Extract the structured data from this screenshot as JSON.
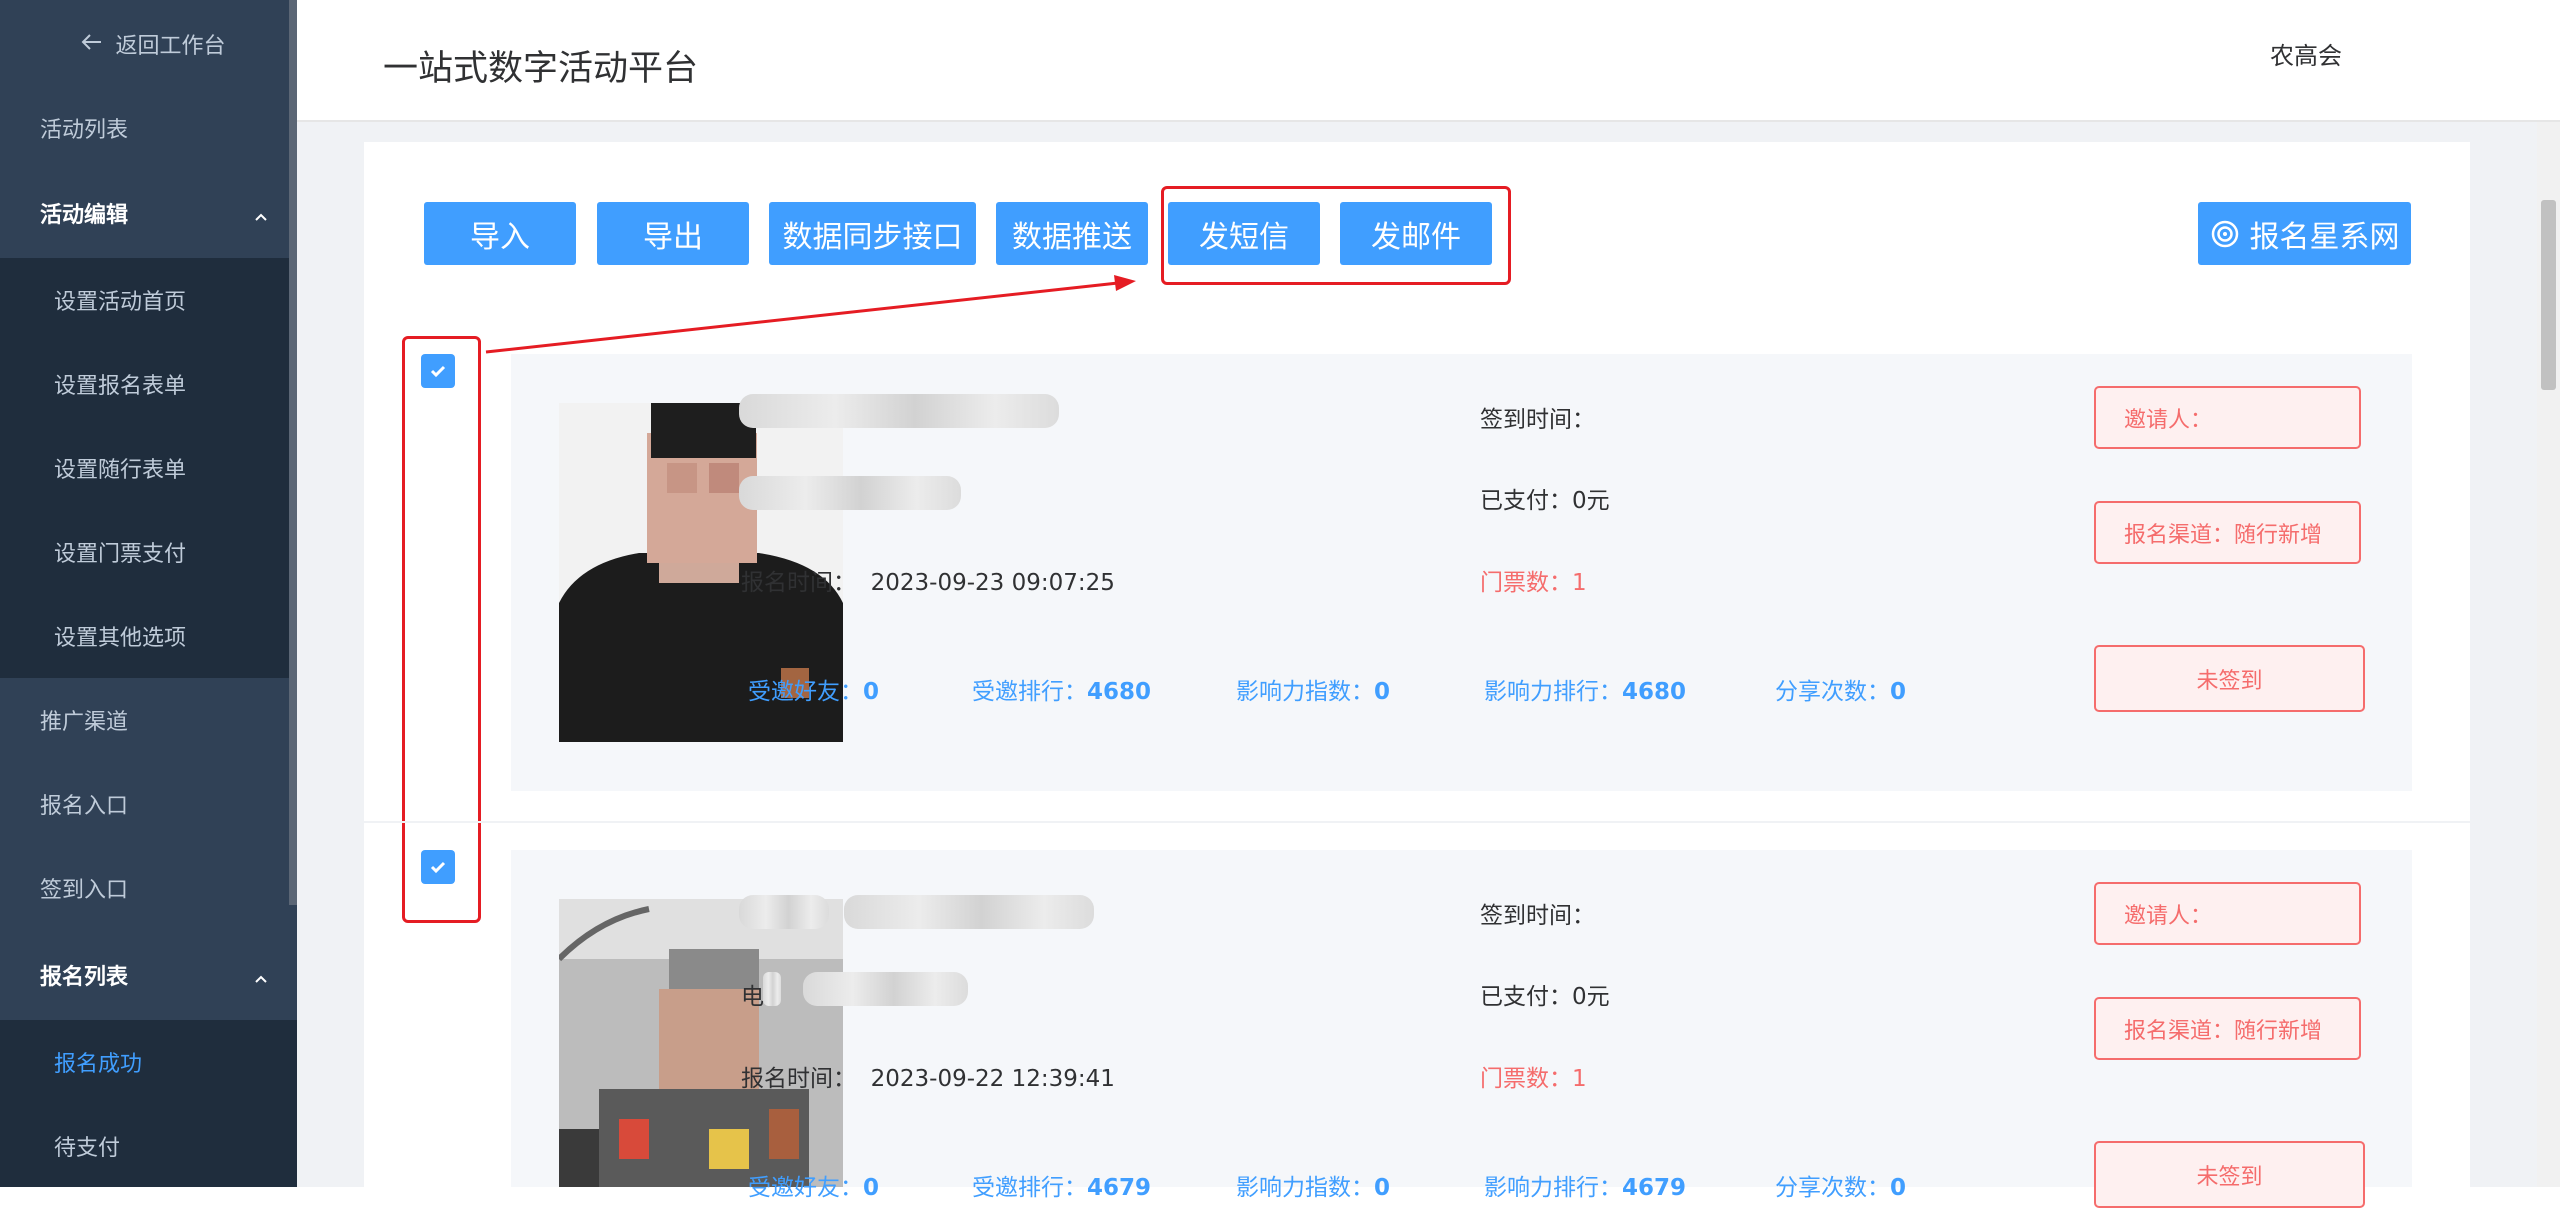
{
  "sidebar": {
    "back_label": "返回工作台",
    "activity_list": "活动列表",
    "activity_edit": "活动编辑",
    "edit_items": [
      "设置活动首页",
      "设置报名表单",
      "设置随行表单",
      "设置门票支付",
      "设置其他选项"
    ],
    "promo_channel": "推广渠道",
    "signup_entry": "报名入口",
    "checkin_entry": "签到入口",
    "signup_list": "报名列表",
    "list_items": [
      "报名成功",
      "待支付"
    ]
  },
  "header": {
    "title": "一站式数字活动平台",
    "user": "农高会"
  },
  "toolbar": {
    "import": "导入",
    "export": "导出",
    "sync": "数据同步接口",
    "push": "数据推送",
    "sms": "发短信",
    "email": "发邮件",
    "brand": "报名星系网"
  },
  "labels": {
    "checkin_time": "签到时间：",
    "paid": "已支付：",
    "signup_time": "报名时间：",
    "tickets": "门票数：",
    "inviter": "邀请人：",
    "channel": "报名渠道：",
    "invited_friends": "受邀好友：",
    "invited_rank": "受邀排行：",
    "influence_index": "影响力指数：",
    "influence_rank": "影响力排行：",
    "share_count": "分享次数："
  },
  "records": [
    {
      "paid": "0元",
      "signup_time": "2023-09-23 09:07:25",
      "tickets": "1",
      "channel": "随行新增",
      "status": "未签到",
      "invited_friends": "0",
      "invited_rank": "4680",
      "influence_index": "0",
      "influence_rank": "4680",
      "share_count": "0",
      "phone_prefix": ""
    },
    {
      "paid": "0元",
      "signup_time": "2023-09-22 12:39:41",
      "tickets": "1",
      "channel": "随行新增",
      "status": "未签到",
      "invited_friends": "0",
      "invited_rank": "4679",
      "influence_index": "0",
      "influence_rank": "4679",
      "share_count": "0",
      "phone_prefix": "电"
    }
  ],
  "colors": {
    "sidebar": "#304156",
    "accent": "#409eff",
    "danger": "#f56c6c",
    "annotation": "#e51c23"
  }
}
